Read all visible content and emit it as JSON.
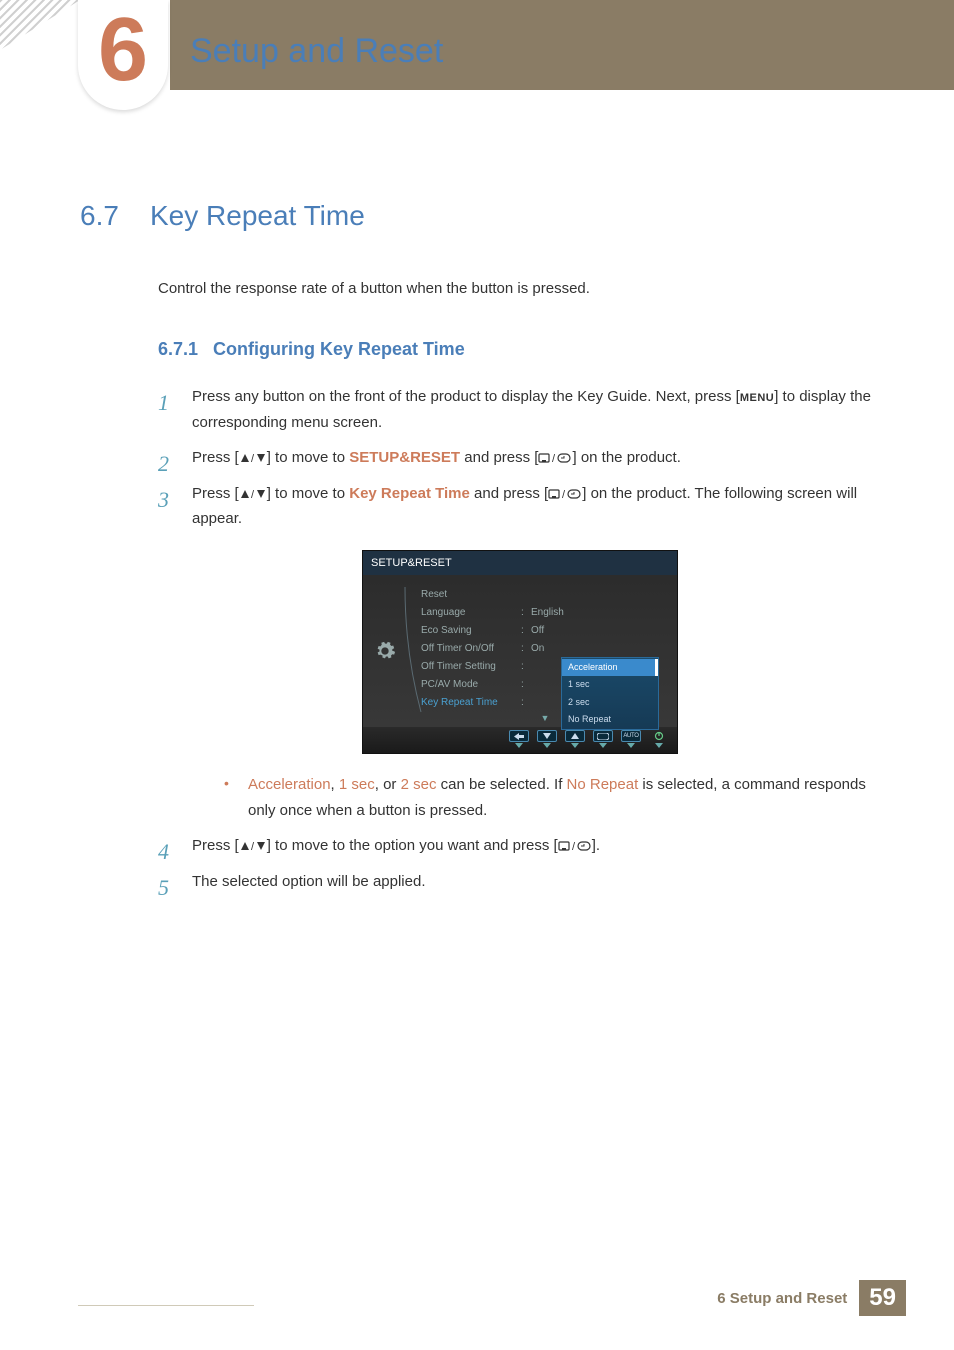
{
  "header": {
    "chapter_number": "6",
    "chapter_title": "Setup and Reset"
  },
  "section": {
    "number": "6.7",
    "title": "Key Repeat Time",
    "intro": "Control the response rate of a button when the button is pressed."
  },
  "subsection": {
    "number": "6.7.1",
    "title": "Configuring Key Repeat Time"
  },
  "steps": {
    "s1_a": "Press any button on the front of the product to display the Key Guide. Next, press [",
    "s1_menu": "MENU",
    "s1_b": "] to display the corresponding menu screen.",
    "s2_a": "Press [",
    "s2_b": "] to move to ",
    "s2_hl": "SETUP&RESET",
    "s2_c": " and press [",
    "s2_d": "] on the product.",
    "s3_a": "Press [",
    "s3_b": "] to move to ",
    "s3_hl": "Key Repeat Time",
    "s3_c": " and press [",
    "s3_d": "] on the product. The following screen will appear.",
    "s4_a": "Press [",
    "s4_b": "] to move to the option you want and press [",
    "s4_c": "].",
    "s5": "The selected option will be applied."
  },
  "bullet": {
    "w1": "Acceleration",
    "t1": ", ",
    "w2": "1 sec",
    "t2": ", or ",
    "w3": "2 sec",
    "t3": " can be selected. If ",
    "w4": "No Repeat",
    "t4": " is selected, a command responds only once when a button is pressed."
  },
  "osd": {
    "title": "SETUP&RESET",
    "rows": [
      {
        "label": "Reset",
        "value": ""
      },
      {
        "label": "Language",
        "value": "English"
      },
      {
        "label": "Eco Saving",
        "value": "Off"
      },
      {
        "label": "Off Timer On/Off",
        "value": "On"
      },
      {
        "label": "Off Timer Setting",
        "value": ""
      },
      {
        "label": "PC/AV Mode",
        "value": ""
      },
      {
        "label": "Key Repeat Time",
        "value": ""
      }
    ],
    "options": [
      "Acceleration",
      "1 sec",
      "2 sec",
      "No Repeat"
    ],
    "selected_option": "Acceleration",
    "footer_auto": "AUTO"
  },
  "footer": {
    "text": "6 Setup and Reset",
    "page": "59"
  }
}
